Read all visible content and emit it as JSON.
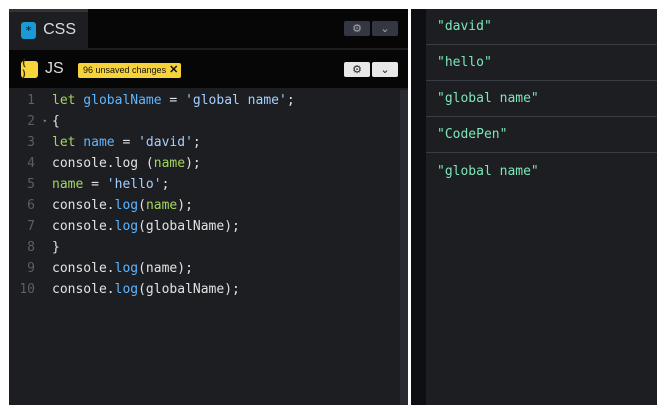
{
  "panels": {
    "css": {
      "label": "CSS",
      "icon": "*"
    },
    "js": {
      "label": "JS",
      "icon": "( )",
      "badge": "96 unsaved changes",
      "badge_close": "✕"
    }
  },
  "buttons": {
    "gear": "⚙",
    "chevron": "⌄"
  },
  "code_lines": [
    {
      "n": "1",
      "fold": ""
    },
    {
      "n": "2",
      "fold": "▾"
    },
    {
      "n": "3",
      "fold": ""
    },
    {
      "n": "4",
      "fold": ""
    },
    {
      "n": "5",
      "fold": ""
    },
    {
      "n": "6",
      "fold": ""
    },
    {
      "n": "7",
      "fold": ""
    },
    {
      "n": "8",
      "fold": ""
    },
    {
      "n": "9",
      "fold": ""
    },
    {
      "n": "10",
      "fold": ""
    }
  ],
  "code": {
    "l1": {
      "kw": "let",
      "var": " globalName",
      "eq": " = ",
      "str": "'global name'",
      "end": ";"
    },
    "l2": {
      "text": "{"
    },
    "l3": {
      "kw": "let",
      "var": " name",
      "eq": " = ",
      "str": "'david'",
      "end": ";"
    },
    "l4": {
      "obj": "console.log ",
      "open": "(",
      "arg": "name",
      "close": ");"
    },
    "l5": {
      "var": "name",
      "eq": " = ",
      "str": "'hello'",
      "end": ";"
    },
    "l6": {
      "obj": "console.",
      "m": "log",
      "open": "(",
      "arg": "name",
      "close": ");"
    },
    "l7": {
      "obj": "console.",
      "m": "log",
      "rest": "(globalName);"
    },
    "l8": {
      "text": "}"
    },
    "l9": {
      "obj": "console.",
      "m": "log",
      "rest": "(name);"
    },
    "l10": {
      "obj": "console.",
      "m": "log",
      "rest": "(globalName);"
    }
  },
  "console_output": [
    "\"david\"",
    "\"hello\"",
    "\"global name\"",
    "\"CodePen\"",
    "\"global name\""
  ],
  "colors": {
    "background": "#1d1e22",
    "badge": "#f7d33a",
    "log_text": "#7ee6b8",
    "keyword": "#a4d65e",
    "identifier": "#5eb5ff"
  }
}
